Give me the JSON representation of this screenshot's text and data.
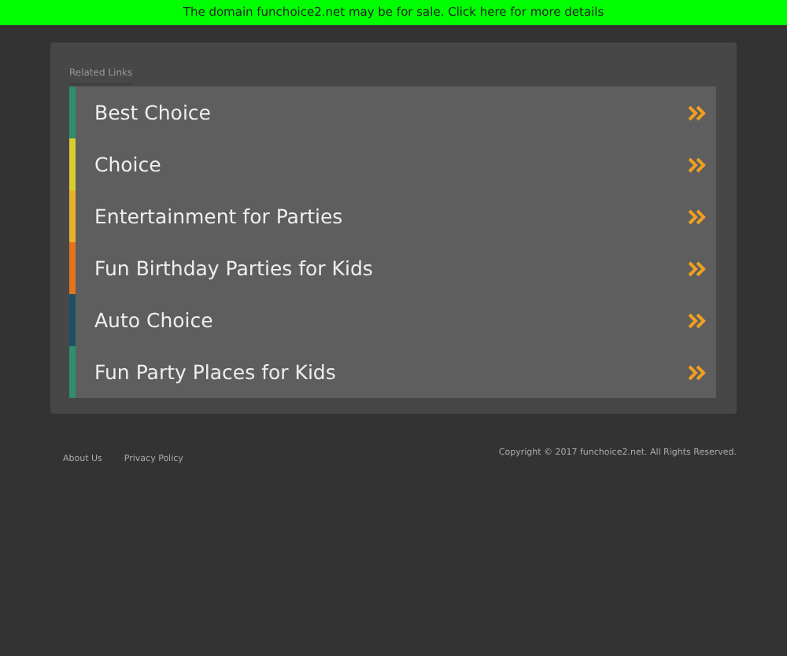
{
  "banner": {
    "text": "The domain funchoice2.net may be for sale. Click here for more details"
  },
  "related_links": {
    "heading": "Related Links",
    "items": [
      {
        "label": "Best Choice",
        "color": "#2e8f6c"
      },
      {
        "label": "Choice",
        "color": "#d8cf2e"
      },
      {
        "label": "Entertainment for Parties",
        "color": "#e8b12a"
      },
      {
        "label": "Fun Birthday Parties for Kids",
        "color": "#e2741e"
      },
      {
        "label": "Auto Choice",
        "color": "#1d5060"
      },
      {
        "label": "Fun Party Places for Kids",
        "color": "#2e8f6c"
      }
    ]
  },
  "footer": {
    "links": [
      "About Us",
      "Privacy Policy"
    ],
    "copyright": "Copyright © 2017 funchoice2.net. All Rights Reserved."
  }
}
